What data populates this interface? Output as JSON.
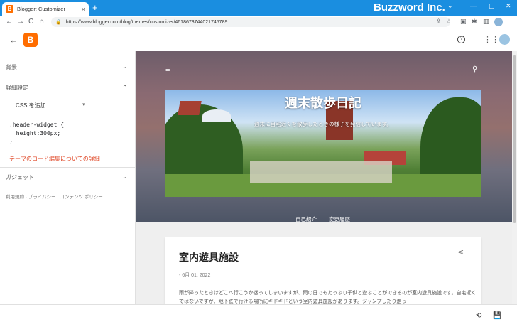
{
  "browser": {
    "tab_title": "Blogger: Customizer",
    "tab_favicon": "B",
    "tab_close": "×",
    "new_tab": "+",
    "brand": "Buzzword Inc.",
    "window_controls": [
      "⌄",
      "—",
      "▢",
      "✕"
    ],
    "url": "https://www.blogger.com/blog/themes/customizer/4618673744021745789",
    "nav": {
      "back": "←",
      "forward": "→",
      "reload": "C",
      "home": "⌂"
    },
    "extensions": [
      "⇪",
      "☆",
      "▣",
      "✱",
      "▥"
    ]
  },
  "header": {
    "back": "←",
    "logo": "B",
    "help": "?",
    "apps": "⋮⋮"
  },
  "left_panel": {
    "sections": [
      {
        "label": "背景",
        "chev": "⌄"
      },
      {
        "label": "詳細設定",
        "chev": "⌃"
      },
      {
        "label": "ガジェット",
        "chev": "⌄"
      }
    ],
    "css_dropdown": {
      "label": "CSS を追加",
      "chev": "▾"
    },
    "code_lines": [
      ".header-widget {",
      "  height:300px;",
      "}"
    ],
    "details_link": "テーマのコード編集についての詳細",
    "footer": "利用規約 · プライバシー · コンテンツ ポリシー"
  },
  "preview": {
    "menu_icon": "≡",
    "search_icon": "⚲",
    "blog_title": "週末散歩日記",
    "blog_description": "週末に自宅近くを散歩したときの様子を発信しています。",
    "nav_links": [
      "自己紹介",
      "変更履歴"
    ],
    "post": {
      "title": "室内遊具施設",
      "share": "⋖",
      "date": "- 6月 01, 2022",
      "body": "雨が降ったときはどこへ行こうか迷ってしまいますが、雨の日でもたっぷり子供と遊ぶことができるのが室内遊具施設です。自宅近くではないですが、地下鉄で行ける場所にキドキドという室内遊具施設があります。ジャンプしたり走っ"
    }
  },
  "bottom": {
    "revert": "⟲",
    "save": "💾"
  },
  "colors": {
    "tabstrip": "#1a8ee0",
    "blogger_orange": "#ff6d00",
    "link_red": "#e04a2a"
  }
}
